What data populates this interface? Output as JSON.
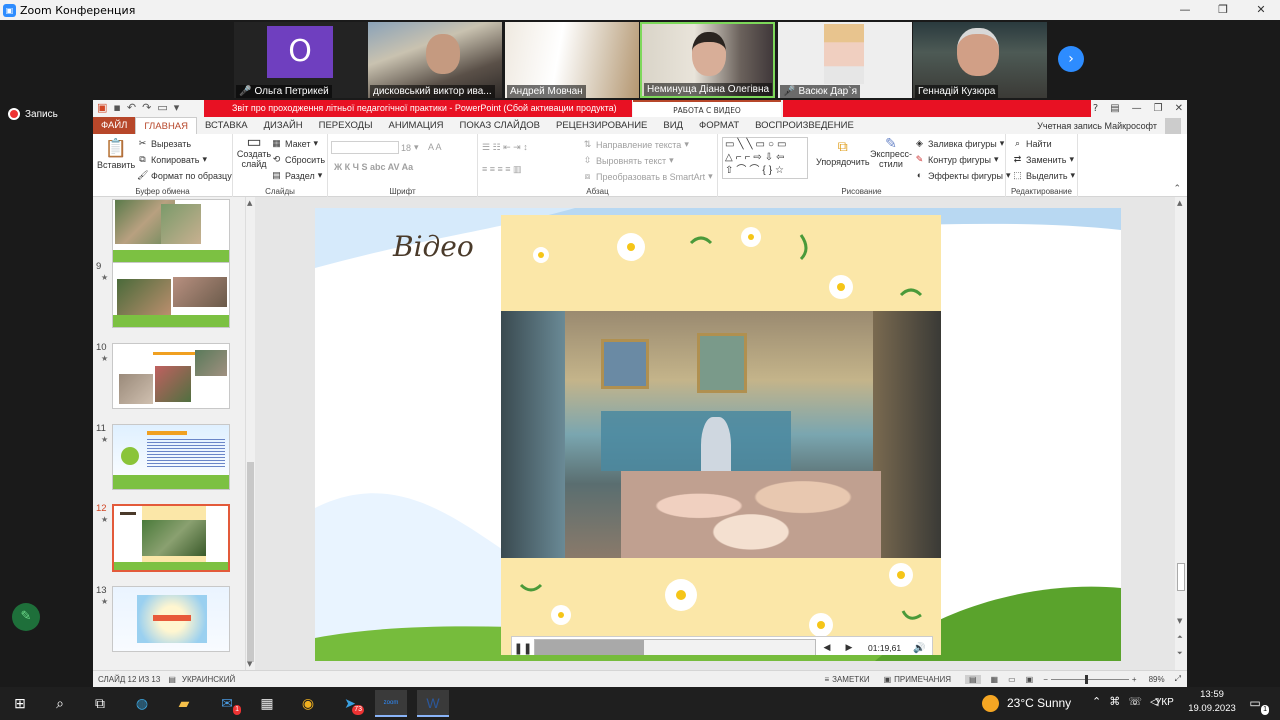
{
  "zoom": {
    "window_title": "Zoom Конференция",
    "record_label": "Запись",
    "participants": [
      {
        "name": "Ольга Петрикей",
        "avatar_letter": "О",
        "muted": true
      },
      {
        "name": "дисковський виктор ива...",
        "muted": false
      },
      {
        "name": "Андрей Мовчан",
        "muted": false
      },
      {
        "name": "Неминуща Діана Олегівна",
        "muted": false
      },
      {
        "name": "Васюк Дар`я",
        "muted": true
      },
      {
        "name": "Геннадій Кузюра",
        "muted": false
      }
    ]
  },
  "ppt": {
    "doc_title": "Звіт про проходження літньої педагогічної практики - PowerPoint (Сбой активации продукта)",
    "context_tab": "РАБОТА С ВИДЕО",
    "tabs": [
      "ФАЙЛ",
      "ГЛАВНАЯ",
      "ВСТАВКА",
      "ДИЗАЙН",
      "ПЕРЕХОДЫ",
      "АНИМАЦИЯ",
      "ПОКАЗ СЛАЙДОВ",
      "РЕЦЕНЗИРОВАНИЕ",
      "ВИД",
      "ФОРМАТ",
      "ВОСПРОИЗВЕДЕНИЕ"
    ],
    "account": "Учетная запись Майкрософт",
    "ribbon": {
      "paste": "Вставить",
      "cut": "Вырезать",
      "copy": "Копировать",
      "format_painter": "Формат по образцу",
      "clipboard_group": "Буфер обмена",
      "new_slide": "Создать слайд",
      "layout": "Макет",
      "reset": "Сбросить",
      "section": "Раздел",
      "slides_group": "Слайды",
      "font_size": "18",
      "font_group": "Шрифт",
      "text_direction": "Направление текста",
      "align_text": "Выровнять текст",
      "convert_smartart": "Преобразовать в SmartArt",
      "paragraph_group": "Абзац",
      "arrange": "Упорядочить",
      "quick_styles": "Экспресс-стили",
      "shape_fill": "Заливка фигуры",
      "shape_outline": "Контур фигуры",
      "shape_effects": "Эффекты фигуры",
      "drawing_group": "Рисование",
      "find": "Найти",
      "replace": "Заменить",
      "select": "Выделить",
      "editing_group": "Редактирование"
    },
    "thumbnails": [
      {
        "num": "",
        "selected": false
      },
      {
        "num": "9",
        "selected": false
      },
      {
        "num": "10",
        "selected": false
      },
      {
        "num": "11",
        "selected": false
      },
      {
        "num": "12",
        "selected": true
      },
      {
        "num": "13",
        "selected": false
      }
    ],
    "slide": {
      "title": "Відео",
      "video_time": "01:19,61",
      "progress": 0.39
    },
    "status": {
      "slide_counter": "СЛАЙД 12 ИЗ 13",
      "language": "УКРАИНСКИЙ",
      "notes": "ЗАМЕТКИ",
      "comments": "ПРИМЕЧАНИЯ",
      "zoom": "89%"
    }
  },
  "taskbar": {
    "telegram_badge": "73",
    "mail_badge": "1",
    "zoom_label": "zoom",
    "weather": "23°C  Sunny",
    "lang": "УКР",
    "time": "13:59",
    "date": "19.09.2023",
    "notif_badge": "1"
  }
}
